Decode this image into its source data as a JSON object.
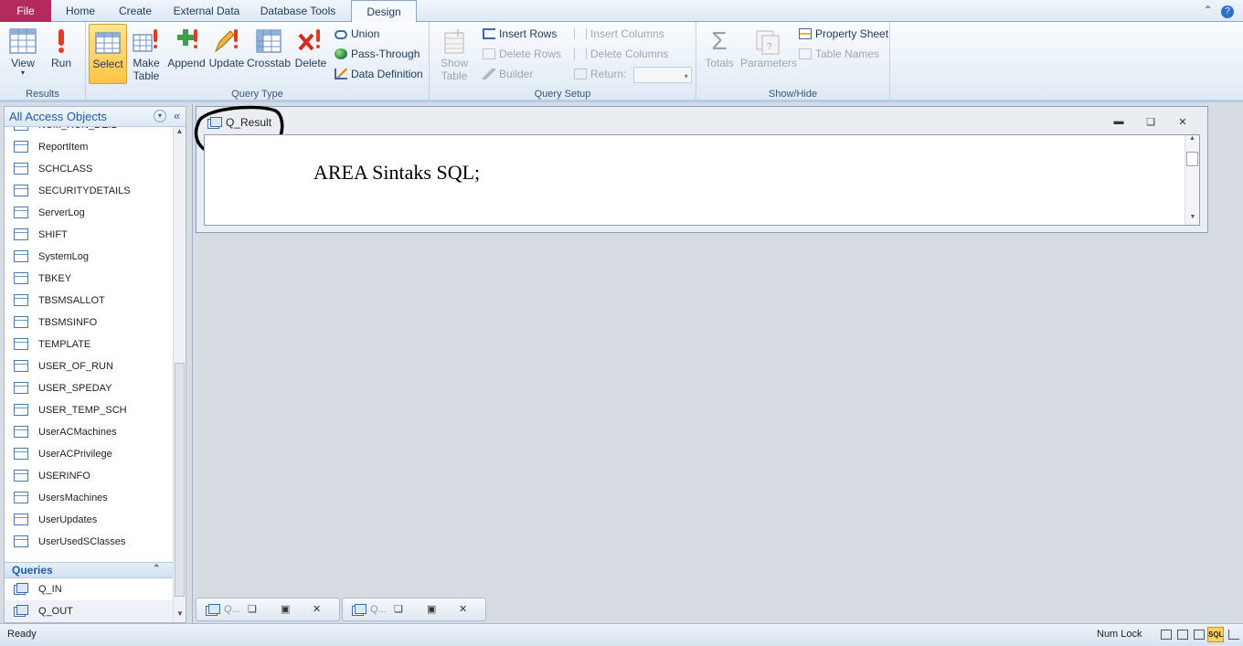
{
  "tabs": {
    "file": "File",
    "home": "Home",
    "create": "Create",
    "external_data": "External Data",
    "database_tools": "Database Tools",
    "design": "Design"
  },
  "ribbon": {
    "results": {
      "label": "Results",
      "view": "View",
      "run": "Run"
    },
    "query_type": {
      "label": "Query Type",
      "select": "Select",
      "make_table": [
        "Make",
        "Table"
      ],
      "append": "Append",
      "update": "Update",
      "crosstab": "Crosstab",
      "delete": "Delete",
      "union": "Union",
      "pass_through": "Pass-Through",
      "data_definition": "Data Definition"
    },
    "query_setup": {
      "label": "Query Setup",
      "show_table": [
        "Show",
        "Table"
      ],
      "insert_rows": "Insert Rows",
      "delete_rows": "Delete Rows",
      "builder": "Builder",
      "insert_columns": "Insert Columns",
      "delete_columns": "Delete Columns",
      "return": "Return:",
      "return_value": ""
    },
    "show_hide": {
      "label": "Show/Hide",
      "totals": "Totals",
      "parameters": "Parameters",
      "property_sheet": "Property Sheet",
      "table_names": "Table Names"
    }
  },
  "nav": {
    "title": "All Access Objects",
    "tables": [
      "NUM_RUN_DEIL",
      "ReportItem",
      "SCHCLASS",
      "SECURITYDETAILS",
      "ServerLog",
      "SHIFT",
      "SystemLog",
      "TBKEY",
      "TBSMSALLOT",
      "TBSMSINFO",
      "TEMPLATE",
      "USER_OF_RUN",
      "USER_SPEDAY",
      "USER_TEMP_SCH",
      "UserACMachines",
      "UserACPrivilege",
      "USERINFO",
      "UsersMachines",
      "UserUpdates",
      "UserUsedSClasses"
    ],
    "queries_header": "Queries",
    "queries": [
      "Q_IN",
      "Q_OUT"
    ]
  },
  "query_window": {
    "title": "Q_Result",
    "sql_text": "AREA Sintaks SQL;"
  },
  "minimized": [
    {
      "label": "Q..."
    },
    {
      "label": "Q..."
    }
  ],
  "status": {
    "text": "Ready",
    "num_lock": "Num Lock",
    "sql_view": "SQL"
  },
  "colors": {
    "file_tab": "#b52a5e",
    "selected_button": "#ffd35e",
    "nav_title": "#1e5da8"
  }
}
